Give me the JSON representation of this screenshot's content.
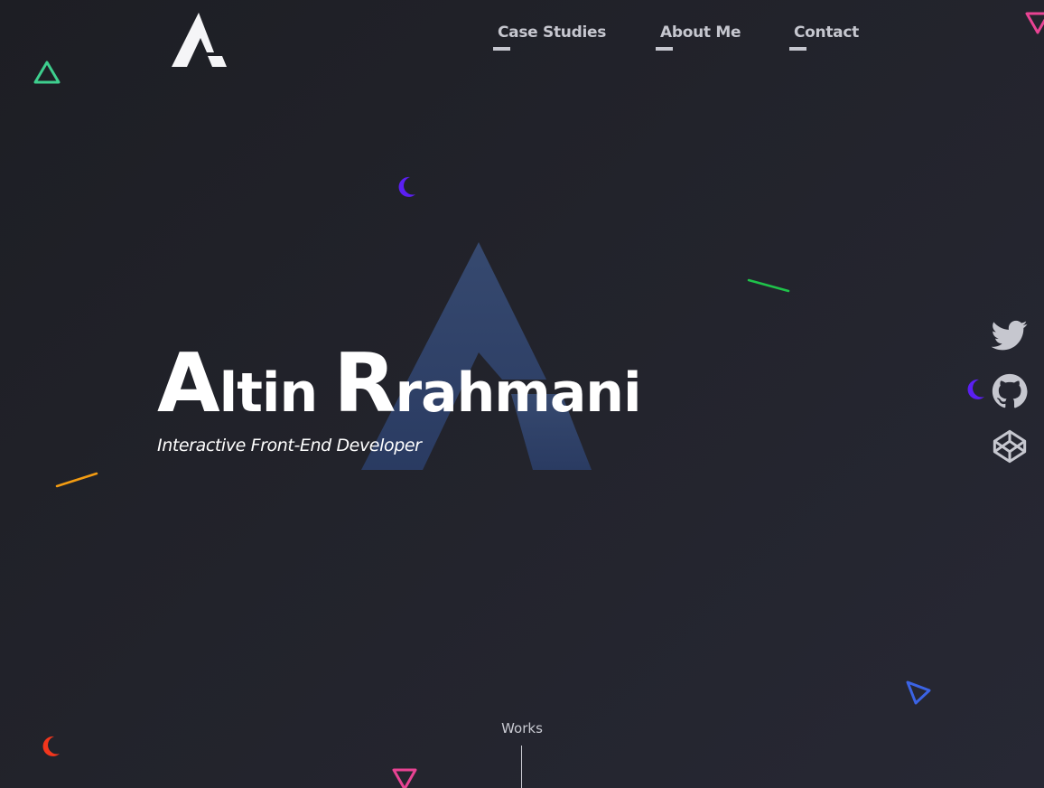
{
  "nav": {
    "items": [
      {
        "label": "Case Studies"
      },
      {
        "label": "About Me"
      },
      {
        "label": "Contact"
      }
    ]
  },
  "hero": {
    "first_initial": "A",
    "first_rest": "ltin",
    "last_initial": "R",
    "last_rest": "rahmani",
    "subtitle": "Interactive Front-End Developer"
  },
  "social": {
    "icons": [
      "twitter-icon",
      "github-icon",
      "codepen-icon"
    ]
  },
  "scroll": {
    "label": "Works"
  },
  "colors": {
    "background": "#23242c",
    "nav_text": "#c6c7cf",
    "logo_a_watermark": "#34466b",
    "shape_green": "#3ecf8e",
    "shape_pink": "#e84393",
    "shape_purple": "#5b1ff2",
    "shape_orange": "#f39c12",
    "shape_red": "#f2361d",
    "shape_blue": "#3b63e4"
  }
}
